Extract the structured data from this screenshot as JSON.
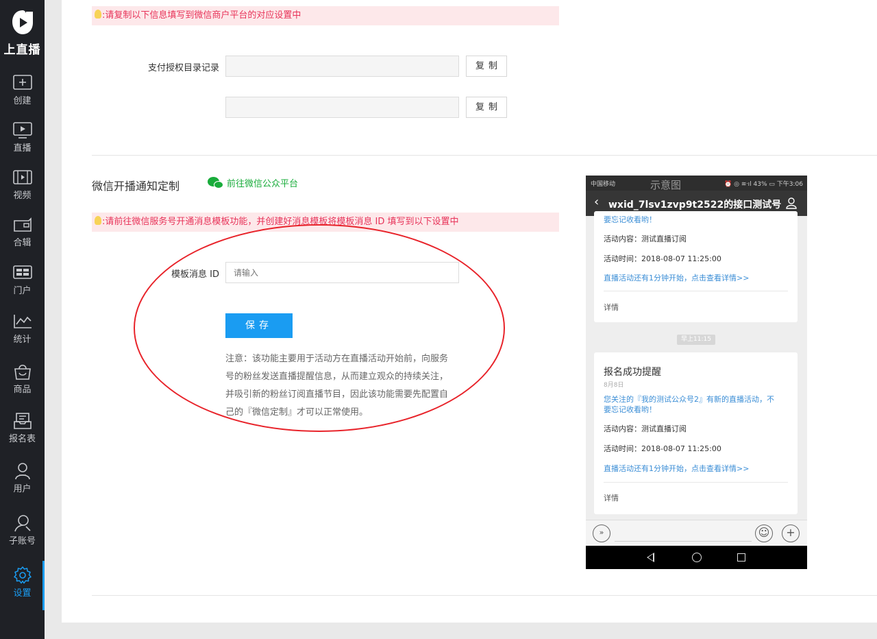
{
  "app": {
    "logo_text": "上直播"
  },
  "sidebar": {
    "items": [
      {
        "label": "创建",
        "icon": "plus-square-icon"
      },
      {
        "label": "直播",
        "icon": "play-screen-icon"
      },
      {
        "label": "视频",
        "icon": "film-icon"
      },
      {
        "label": "合辑",
        "icon": "folder-icon"
      },
      {
        "label": "门户",
        "icon": "portal-grid-icon"
      },
      {
        "label": "统计",
        "icon": "line-chart-icon"
      },
      {
        "label": "商品",
        "icon": "shopping-bag-icon"
      },
      {
        "label": "报名表",
        "icon": "form-tray-icon"
      },
      {
        "label": "用户",
        "icon": "user-icon"
      },
      {
        "label": "子账号",
        "icon": "sub-account-icon"
      },
      {
        "label": "设置",
        "icon": "gear-icon",
        "active": true
      }
    ],
    "accent_color": "#1a9cf2"
  },
  "payment": {
    "tip": ":请复制以下信息填写到微信商户平台的对应设置中",
    "label": "支付授权目录记录",
    "fields": [
      "",
      ""
    ],
    "copy_label": "复制"
  },
  "notify": {
    "title": "微信开播通知定制",
    "link": "前往微信公众平台",
    "tip": ":请前往微信服务号开通消息模板功能，并创建好消息模板将模板消息 ID 填写到以下设置中",
    "template_label": "模板消息 ID",
    "template_placeholder": "请输入",
    "save_label": "保存",
    "note_lines": [
      "注意：该功能主要用于活动方在直播活动开始前，向服务",
      "号的粉丝发送直播提醒信息，从而建立观众的持续关注，",
      "并吸引新的粉丝订阅直播节目，因此该功能需要先配置自",
      "己的『微信定制』才可以正常使用。"
    ]
  },
  "phone": {
    "carrier": "中国移动",
    "watermark": "示意图",
    "status_right": "⏰ ◎ ≋ᐧıl 43% ▭ 下午3:06",
    "header_title": "wxid_7lsv1zvp9t2522的接口测试号",
    "back_glyph": "‹",
    "card1": {
      "top_line": "要忘记收看哟！",
      "content": "活动内容：测试直播订阅",
      "time": "活动时间：2018-08-07 11:25:00",
      "cta": "直播活动还有1分钟开始，点击查看详情>>",
      "detail": "详情"
    },
    "time_pill": "早上11:15",
    "card2": {
      "title": "报名成功提醒",
      "date": "8月8日",
      "desc1": "您关注的『我的测试公众号2』有新的直播活动，不",
      "desc2": "要忘记收看哟！",
      "content": "活动内容：测试直播订阅",
      "time": "活动时间：2018-08-07 11:25:00",
      "cta": "直播活动还有1分钟开始，点击查看详情>>",
      "detail": "详情"
    }
  },
  "colors": {
    "tip_bg": "#fde8ea",
    "tip_text": "#e8345a",
    "wechat_green": "#19ac3b",
    "annotation_red": "#e8232a"
  }
}
